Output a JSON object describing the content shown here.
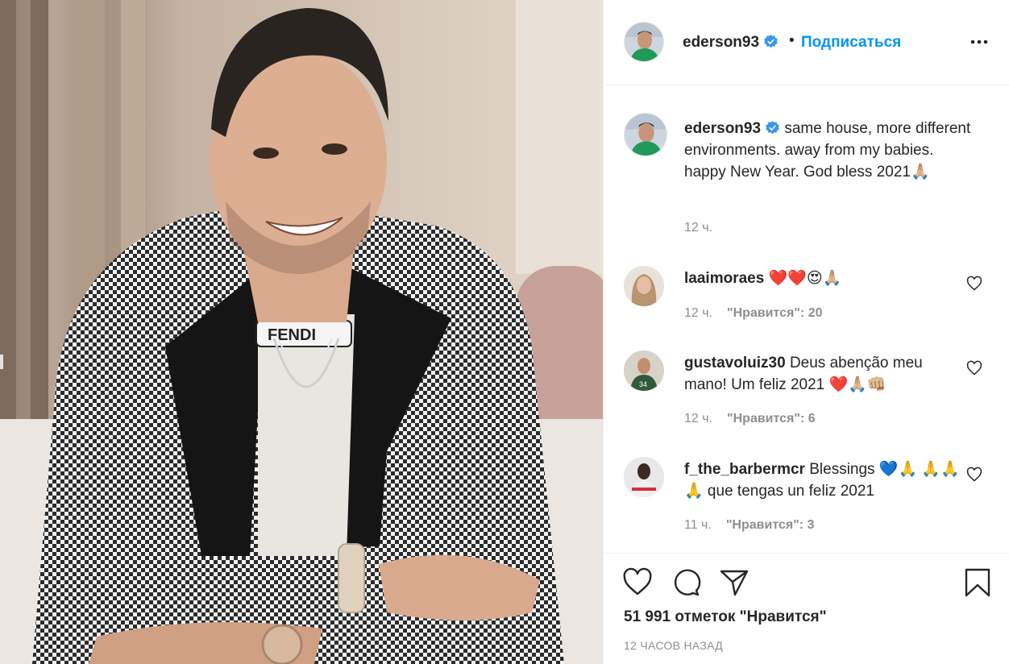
{
  "post": {
    "author": "ederson93",
    "follow_label": "Подписаться",
    "separator": "•",
    "caption_line1": "same house, more different environments. away from my babies.",
    "caption_line2": "happy New Year. God bless 2021🙏🏼",
    "caption_time": "12 ч.",
    "likes_text": "51 991 отметок \"Нравится\"",
    "posted_ago": "12 ЧАСОВ НАЗАД"
  },
  "comments": [
    {
      "user": "laaimoraes",
      "text": "❤️❤️😍🙏🏼",
      "time": "12 ч.",
      "likes": "\"Нравится\": 20"
    },
    {
      "user": "gustavoluiz30",
      "text": "Deus abenção meu mano! Um feliz 2021 ❤️🙏🏼👊🏼",
      "time": "12 ч.",
      "likes": "\"Нравится\": 6"
    },
    {
      "user": "f_the_barbermcr",
      "text": "Blessings 💙🙏 🙏🙏🙏 que tengas un feliz 2021",
      "time": "11 ч.",
      "likes": "\"Нравится\": 3"
    }
  ],
  "icons": {
    "verified": "verified-badge-icon",
    "more": "more-options-icon",
    "like": "heart-icon",
    "comment": "comment-icon",
    "share": "paper-plane-icon",
    "save": "bookmark-icon"
  },
  "colors": {
    "link": "#0095f6",
    "verified": "#3897f0",
    "muted": "#8e8e8e",
    "text": "#262626"
  }
}
